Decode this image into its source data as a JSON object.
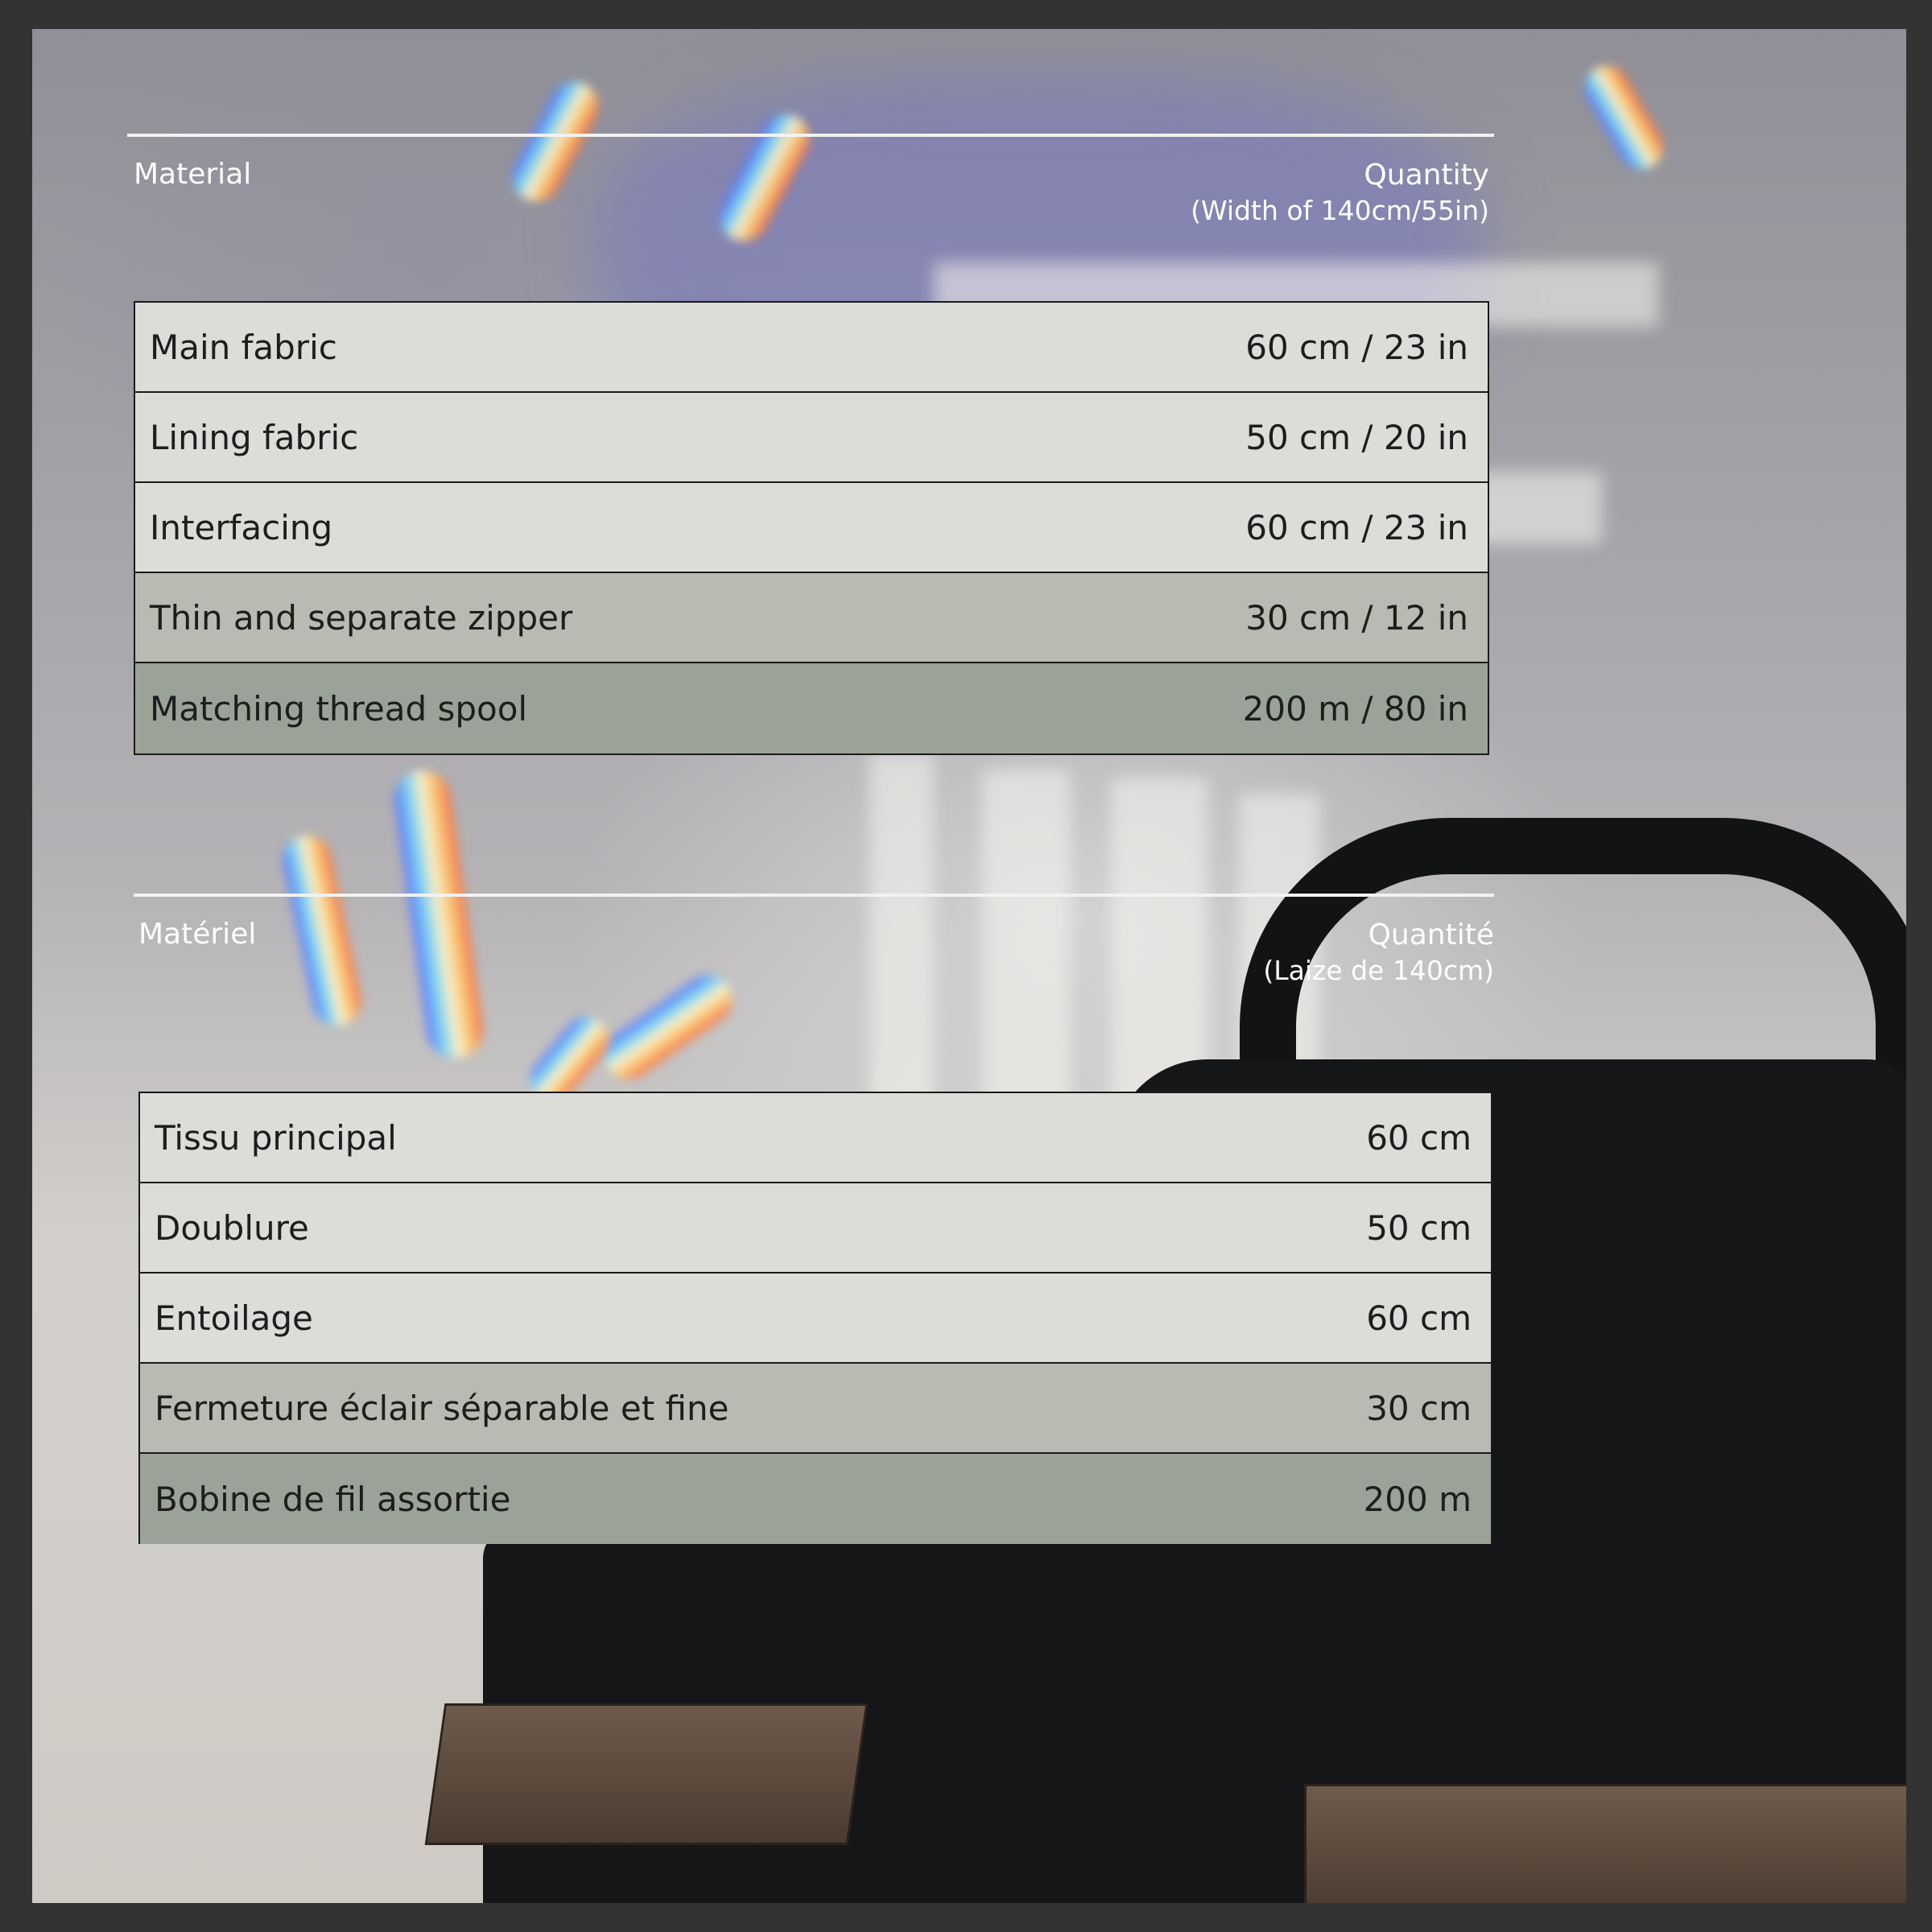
{
  "english": {
    "material_label": "Material",
    "quantity_label": "Quantity",
    "quantity_sub": "(Width of 140cm/55in)",
    "rows": [
      {
        "name": "Main fabric",
        "qty": "60 cm / 23 in"
      },
      {
        "name": "Lining fabric",
        "qty": "50 cm / 20 in"
      },
      {
        "name": "Interfacing",
        "qty": "60 cm / 23 in"
      },
      {
        "name": "Thin and separate zipper",
        "qty": "30 cm / 12 in"
      },
      {
        "name": "Matching thread spool",
        "qty": "200 m / 80 in"
      }
    ]
  },
  "french": {
    "material_label": "Matériel",
    "quantity_label": "Quantité",
    "quantity_sub": "(Laize de 140cm)",
    "rows": [
      {
        "name": "Tissu principal",
        "qty": "60 cm"
      },
      {
        "name": "Doublure",
        "qty": "50 cm"
      },
      {
        "name": "Entoilage",
        "qty": "60 cm"
      },
      {
        "name": "Fermeture éclair séparable et fine",
        "qty": "30 cm"
      },
      {
        "name": "Bobine de fil assortie",
        "qty": "200 m"
      }
    ]
  },
  "colors": {
    "frame": "#333333",
    "row_light": "#dcdcd9",
    "row_mid": "#b7bbb2",
    "row_dark": "#9ba298"
  }
}
